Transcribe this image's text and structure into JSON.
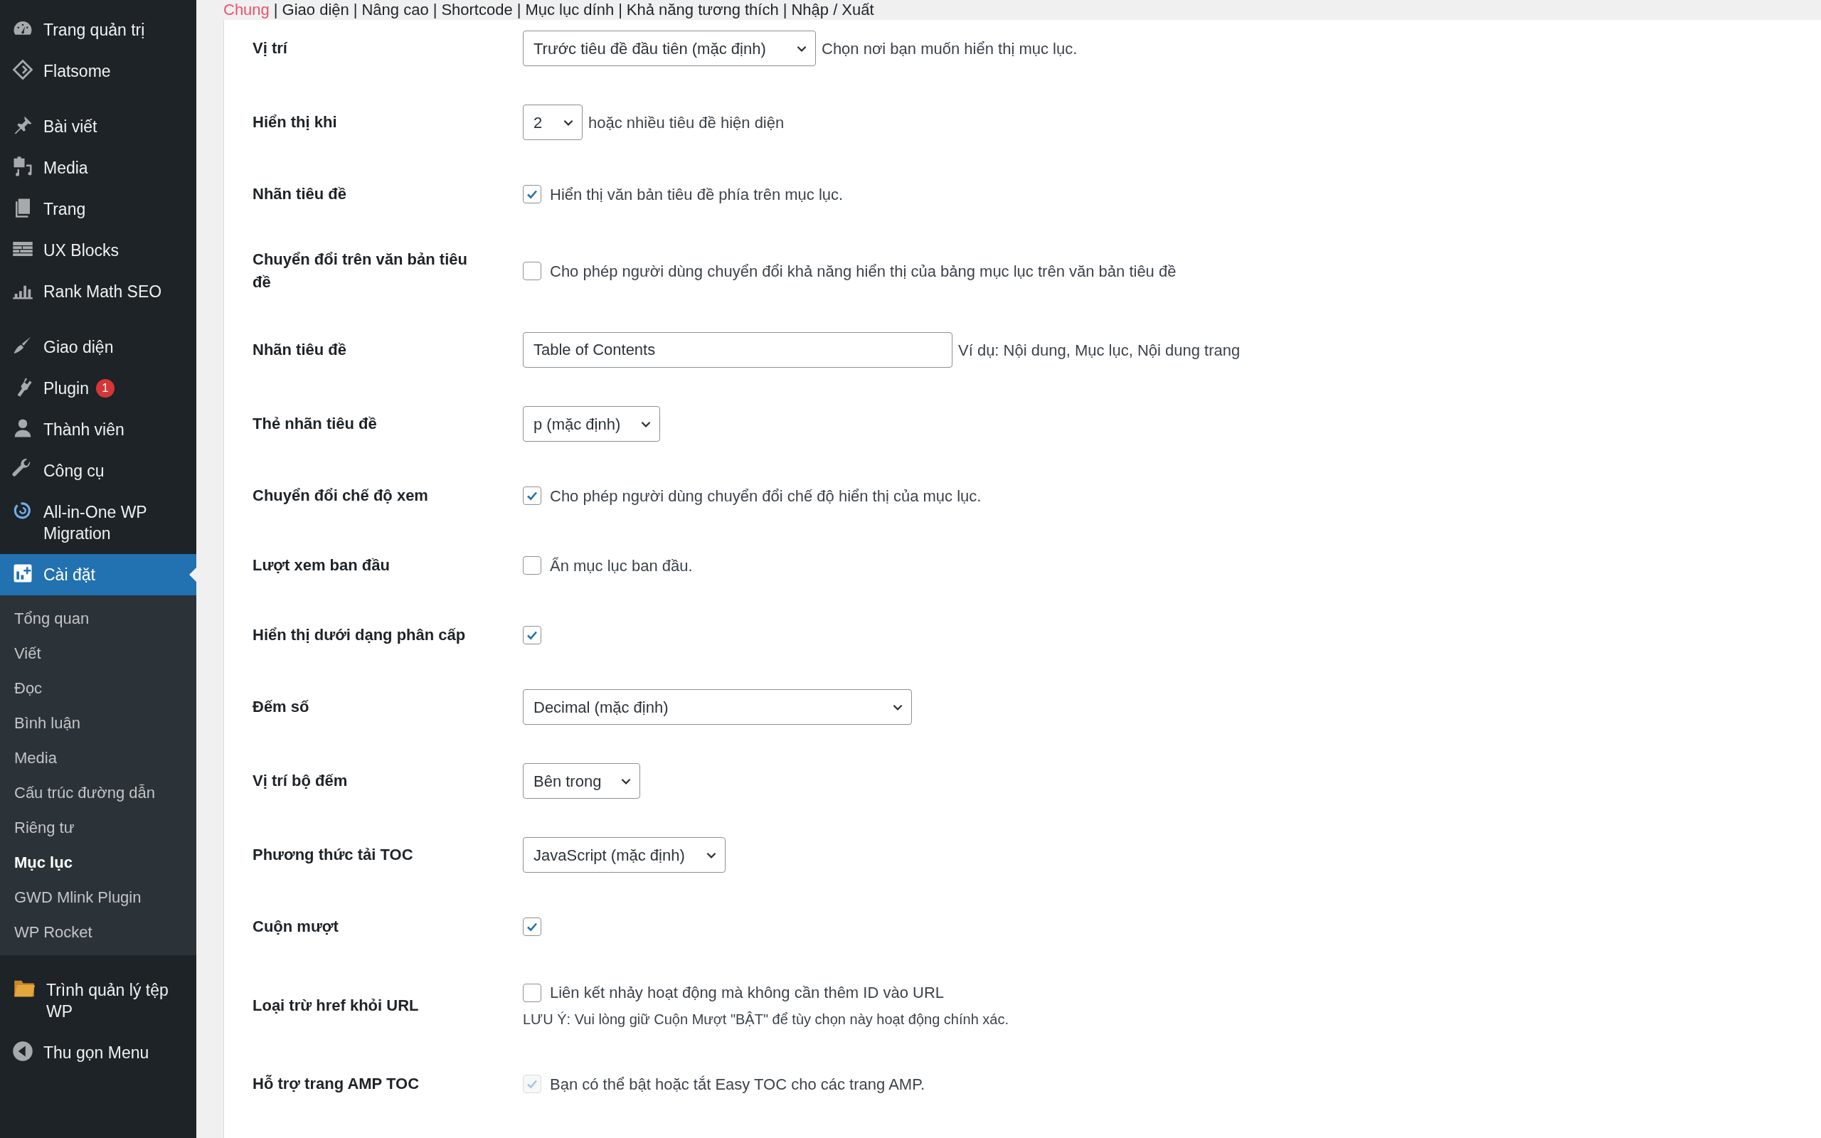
{
  "sidebar": {
    "groups": [
      [
        {
          "label": "Trang quản trị",
          "selected": false
        },
        {
          "label": "Flatsome",
          "selected": false
        }
      ],
      [
        {
          "label": "Bài viết",
          "selected": false
        },
        {
          "label": "Media",
          "selected": false
        },
        {
          "label": "Trang",
          "selected": false
        },
        {
          "label": "UX Blocks",
          "selected": false
        },
        {
          "label": "Rank Math SEO",
          "selected": false
        }
      ],
      [
        {
          "label": "Giao diện",
          "selected": false
        },
        {
          "label": "Plugin",
          "badge": "1",
          "selected": false
        },
        {
          "label": "Thành viên",
          "selected": false
        },
        {
          "label": "Công cụ",
          "selected": false
        },
        {
          "label": "All-in-One WP Migration",
          "selected": false
        },
        {
          "label": "Cài đặt",
          "selected": true,
          "children": [
            {
              "label": "Tổng quan",
              "selected": false
            },
            {
              "label": "Viết",
              "selected": false
            },
            {
              "label": "Đọc",
              "selected": false
            },
            {
              "label": "Bình luận",
              "selected": false
            },
            {
              "label": "Media",
              "selected": false
            },
            {
              "label": "Cấu trúc đường dẫn",
              "selected": false
            },
            {
              "label": "Riêng tư",
              "selected": false
            },
            {
              "label": "Mục lục",
              "selected": true
            },
            {
              "label": "GWD Mlink Plugin",
              "selected": false
            },
            {
              "label": "WP Rocket",
              "selected": false
            }
          ]
        }
      ],
      [
        {
          "label": "Trình quản lý tệp WP",
          "selected": false
        },
        {
          "label": "Thu gọn Menu",
          "selected": false
        }
      ]
    ]
  },
  "tabs": {
    "separator": "|",
    "items": [
      {
        "label": "Chung",
        "selected": true
      },
      {
        "label": "Giao diện",
        "selected": false
      },
      {
        "label": "Nâng cao",
        "selected": false
      },
      {
        "label": "Shortcode",
        "selected": false
      },
      {
        "label": "Mục lục dính",
        "selected": false
      },
      {
        "label": "Khả năng tương thích",
        "selected": false
      },
      {
        "label": "Nhập / Xuất",
        "selected": false
      }
    ]
  },
  "settings": [
    {
      "label": "Vị trí",
      "kind": "select",
      "value": "Trước tiêu đề đầu tiên (mặc định)",
      "description": "Chọn nơi bạn muốn hiển thị mục lục."
    },
    {
      "label": "Hiển thị khi",
      "kind": "select",
      "value": "2",
      "description": "hoặc nhiều tiêu đề hiện diện"
    },
    {
      "label": "Nhãn tiêu đề",
      "kind": "checkbox",
      "checked": true,
      "disabled": false,
      "text": "Hiển thị văn bản tiêu đề phía trên mục lục."
    },
    {
      "label": "Chuyển đổi trên văn bản tiêu đề",
      "kind": "checkbox",
      "checked": false,
      "disabled": false,
      "text": "Cho phép người dùng chuyển đổi khả năng hiển thị của bảng mục lục trên văn bản tiêu đề"
    },
    {
      "label": "Nhãn tiêu đề",
      "kind": "text",
      "value": "Table of Contents",
      "description": "Ví dụ: Nội dung, Mục lục, Nội dung trang"
    },
    {
      "label": "Thẻ nhãn tiêu đề",
      "kind": "select",
      "value": "p (mặc định)"
    },
    {
      "label": "Chuyển đổi chế độ xem",
      "kind": "checkbox",
      "checked": true,
      "disabled": false,
      "text": "Cho phép người dùng chuyển đổi chế độ hiển thị của mục lục."
    },
    {
      "label": "Lượt xem ban đầu",
      "kind": "checkbox",
      "checked": false,
      "disabled": false,
      "text": "Ẩn mục lục ban đầu."
    },
    {
      "label": "Hiển thị dưới dạng phân cấp",
      "kind": "checkbox",
      "checked": true,
      "disabled": false
    },
    {
      "label": "Đếm số",
      "kind": "select",
      "value": "Decimal (mặc định)"
    },
    {
      "label": "Vị trí bộ đếm",
      "kind": "select",
      "value": "Bên trong"
    },
    {
      "label": "Phương thức tải TOC",
      "kind": "select",
      "value": "JavaScript (mặc định)"
    },
    {
      "label": "Cuộn mượt",
      "kind": "checkbox",
      "checked": true,
      "disabled": false
    },
    {
      "label": "Loại trừ href khỏi URL",
      "kind": "checkbox",
      "checked": false,
      "disabled": false,
      "text": "Liên kết nhảy hoạt động mà không cần thêm ID vào URL",
      "note": "LƯU Ý: Vui lòng giữ Cuộn Mượt \"BẬT\" để tùy chọn này hoạt động chính xác."
    },
    {
      "label": "Hỗ trợ trang AMP TOC",
      "kind": "checkbox",
      "checked": true,
      "disabled": true,
      "text": "Bạn có thể bật hoặc tắt Easy TOC cho các trang AMP."
    }
  ]
}
